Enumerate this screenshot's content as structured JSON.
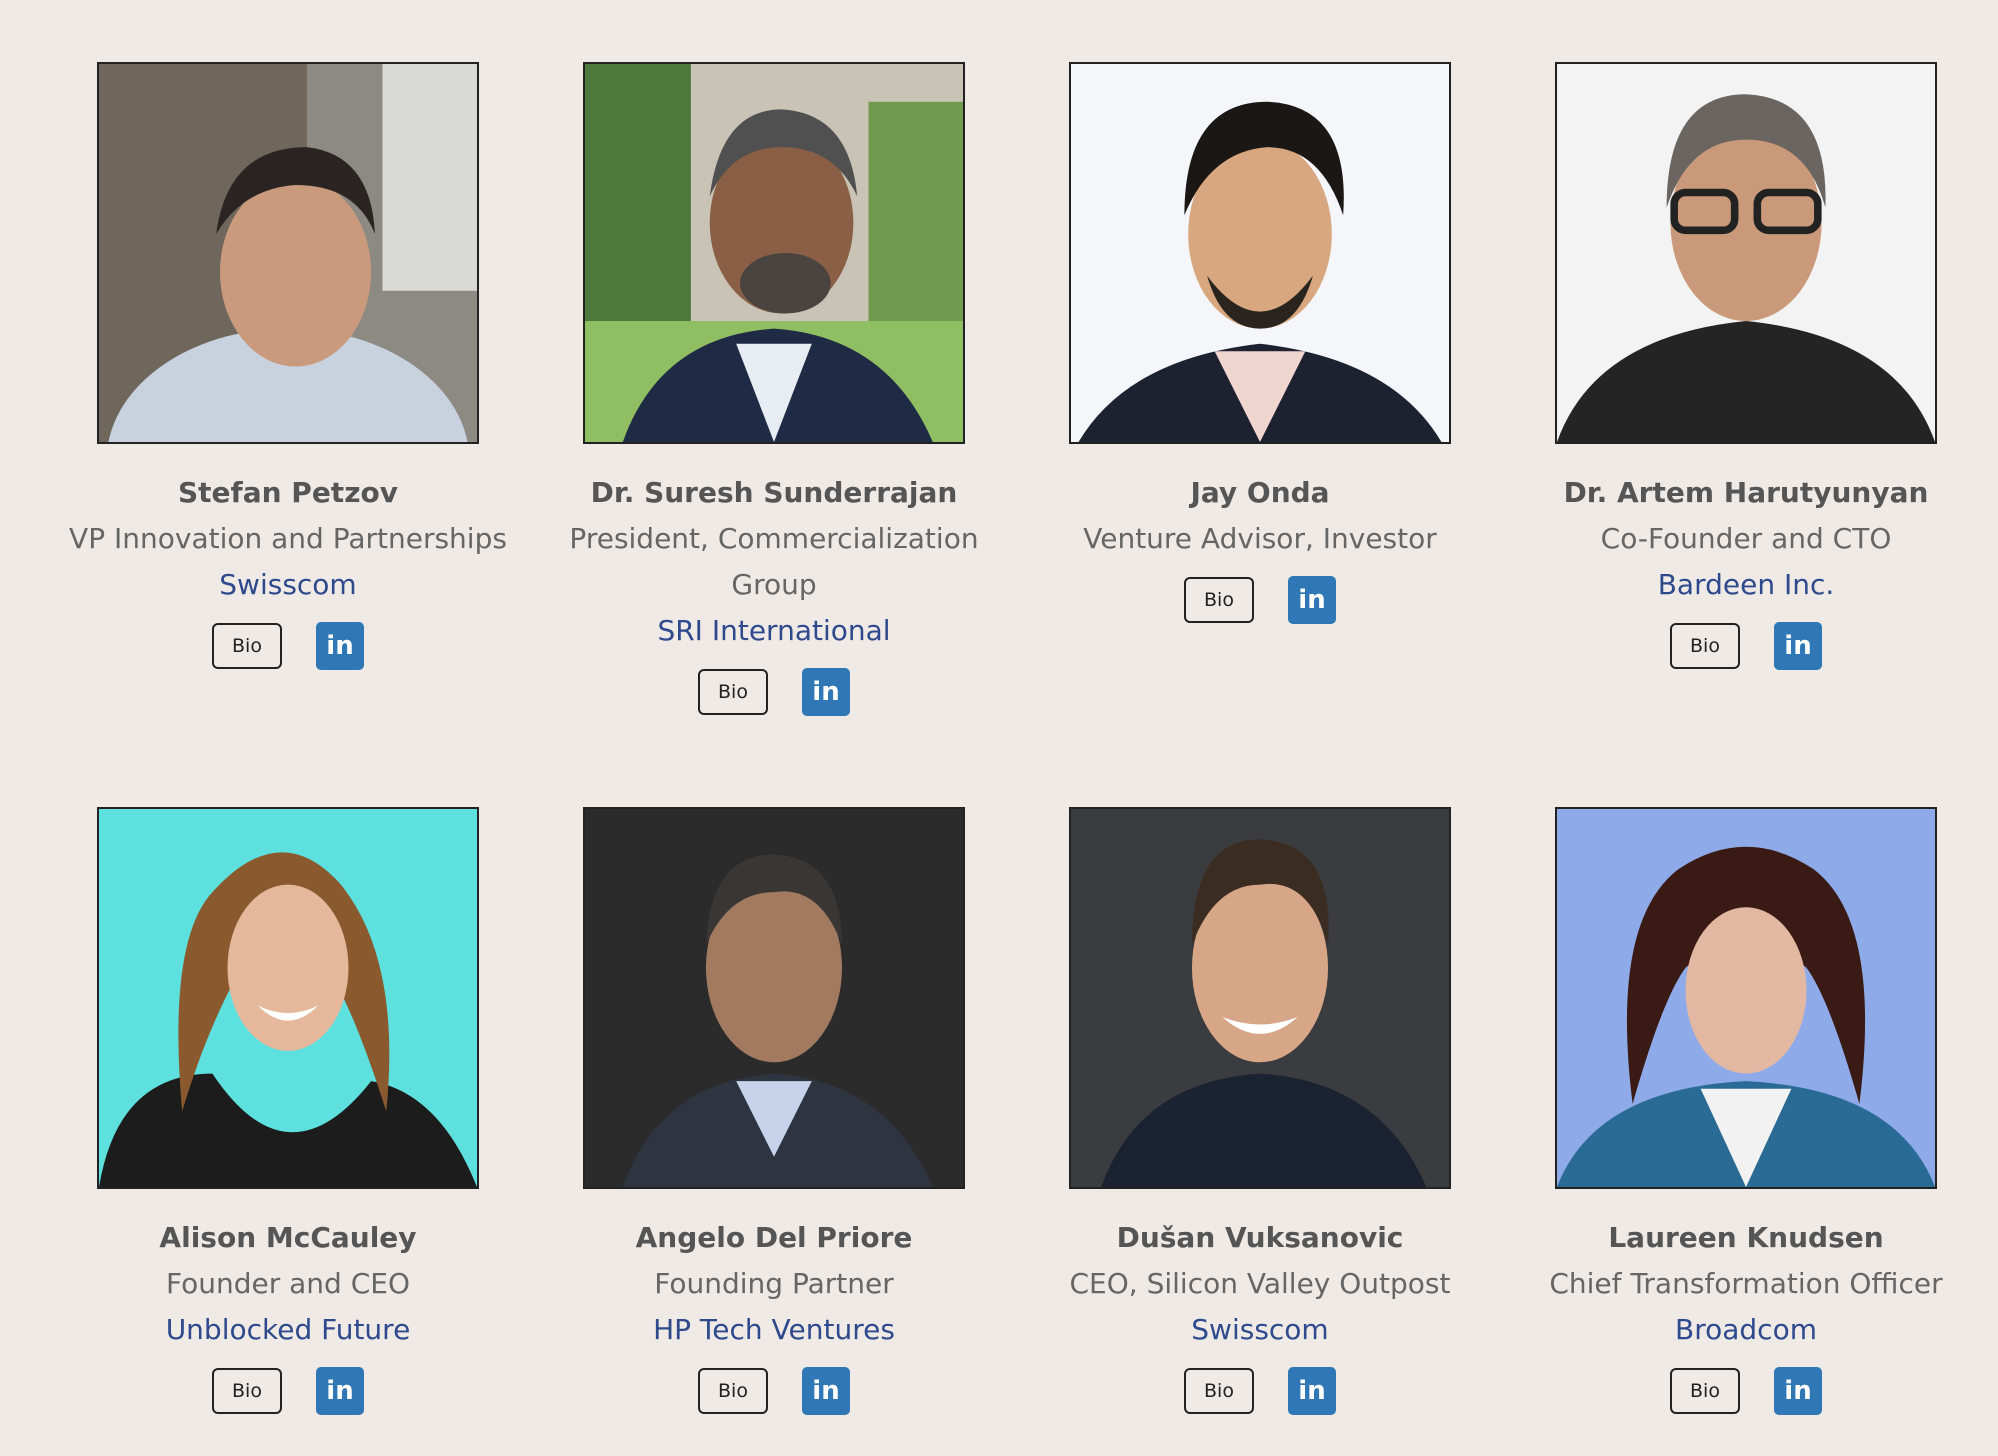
{
  "colors": {
    "background": "#efeae6",
    "name": "#555555",
    "title": "#666666",
    "company": "#2e4a8c",
    "linkedin": "#2f77b5"
  },
  "people": [
    {
      "name": "Stefan Petzov",
      "title": "VP Innovation and Partnerships",
      "company": "Swisscom",
      "bio_label": "Bio",
      "linkedin_label": "in",
      "photo_bg": "#8a8a84"
    },
    {
      "name": "Dr. Suresh Sunderrajan",
      "title": "President, Commercialization Group",
      "company": "SRI International",
      "bio_label": "Bio",
      "linkedin_label": "in",
      "photo_bg": "#7fa36a"
    },
    {
      "name": "Jay Onda",
      "title": "Venture Advisor, Investor",
      "company": "",
      "bio_label": "Bio",
      "linkedin_label": "in",
      "photo_bg": "#f4f6fa"
    },
    {
      "name": "Dr. Artem Harutyunyan",
      "title": "Co-Founder and CTO",
      "company": "Bardeen Inc.",
      "bio_label": "Bio",
      "linkedin_label": "in",
      "photo_bg": "#f3f3f3"
    },
    {
      "name": "Alison McCauley",
      "title": "Founder and CEO",
      "company": "Unblocked Future",
      "bio_label": "Bio",
      "linkedin_label": "in",
      "photo_bg": "#5ee0df"
    },
    {
      "name": "Angelo Del Priore",
      "title": "Founding Partner",
      "company": "HP Tech Ventures",
      "bio_label": "Bio",
      "linkedin_label": "in",
      "photo_bg": "#2b2b2b"
    },
    {
      "name": "Dušan Vuksanovic",
      "title": "CEO, Silicon Valley Outpost",
      "company": "Swisscom",
      "bio_label": "Bio",
      "linkedin_label": "in",
      "photo_bg": "#3b3c3f"
    },
    {
      "name": "Laureen Knudsen",
      "title": "Chief Transformation Officer",
      "company": "Broadcom",
      "bio_label": "Bio",
      "linkedin_label": "in",
      "photo_bg": "#8eaae8"
    }
  ]
}
